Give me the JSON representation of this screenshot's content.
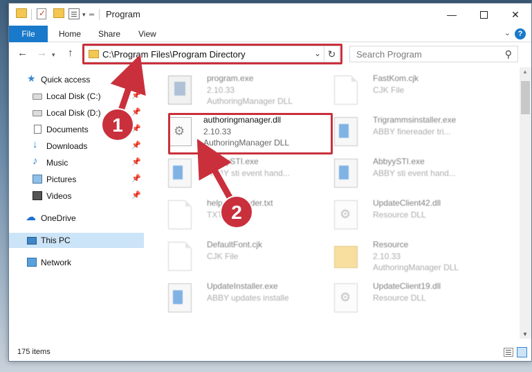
{
  "window": {
    "title": "Program"
  },
  "ribbon": {
    "tabs": [
      "File",
      "Home",
      "Share",
      "View"
    ]
  },
  "address": {
    "path": "C:\\Program Files\\Program Directory"
  },
  "search": {
    "placeholder": "Search Program"
  },
  "sidebar": {
    "items": [
      {
        "label": "Quick access",
        "icon": "star-icon"
      },
      {
        "label": "Local Disk (C:)",
        "icon": "drive-icon",
        "pinned": true
      },
      {
        "label": "Local Disk (D:)",
        "icon": "drive-icon",
        "pinned": true
      },
      {
        "label": "Documents",
        "icon": "documents-icon",
        "pinned": true
      },
      {
        "label": "Downloads",
        "icon": "download-icon",
        "pinned": true
      },
      {
        "label": "Music",
        "icon": "music-icon",
        "pinned": true
      },
      {
        "label": "Pictures",
        "icon": "pictures-icon",
        "pinned": true
      },
      {
        "label": "Videos",
        "icon": "videos-icon",
        "pinned": true
      },
      {
        "label": "OneDrive",
        "icon": "cloud-icon"
      },
      {
        "label": "This PC",
        "icon": "computer-icon",
        "selected": true
      },
      {
        "label": "Network",
        "icon": "network-icon"
      }
    ]
  },
  "files": [
    {
      "name": "program.exe",
      "line1": "2.10.33",
      "line2": "AuthoringManager DLL",
      "icon": "setup"
    },
    {
      "name": "FastKom.cjk",
      "line1": "CJK File",
      "line2": "",
      "icon": "blank"
    },
    {
      "name": "authoringmanager.dll",
      "line1": "2.10.33",
      "line2": "AuthoringManager DLL",
      "icon": "dll",
      "focus": true
    },
    {
      "name": "Trigrammsinstaller.exe",
      "line1": "ABBY finereader tri...",
      "line2": "",
      "icon": "exe"
    },
    {
      "name": "AbbyySTI.exe",
      "line1": "ABBY sti event hand...",
      "line2": "",
      "icon": "exe"
    },
    {
      "name": "AbbyySTI.exe",
      "line1": "ABBY sti event hand...",
      "line2": "",
      "icon": "exe"
    },
    {
      "name": "help.finereader.txt",
      "line1": "TXT File",
      "line2": "",
      "icon": "blank"
    },
    {
      "name": "UpdateClient42.dll",
      "line1": "Resource DLL",
      "line2": "",
      "icon": "dll"
    },
    {
      "name": "DefaultFont.cjk",
      "line1": "CJK File",
      "line2": "",
      "icon": "blank"
    },
    {
      "name": "Resource",
      "line1": "2.10.33",
      "line2": "AuthoringManager DLL",
      "icon": "folder"
    },
    {
      "name": "UpdateInstaller.exe",
      "line1": "ABBY updates installe",
      "line2": "",
      "icon": "exe"
    },
    {
      "name": "UpdateClient19.dll",
      "line1": "Resource DLL",
      "line2": "",
      "icon": "dll"
    }
  ],
  "status": {
    "item_count": "175 items"
  },
  "callouts": {
    "one": "1",
    "two": "2"
  },
  "colors": {
    "accent": "#1979ca",
    "highlight": "#c9303c",
    "selected": "#cce4f7"
  }
}
